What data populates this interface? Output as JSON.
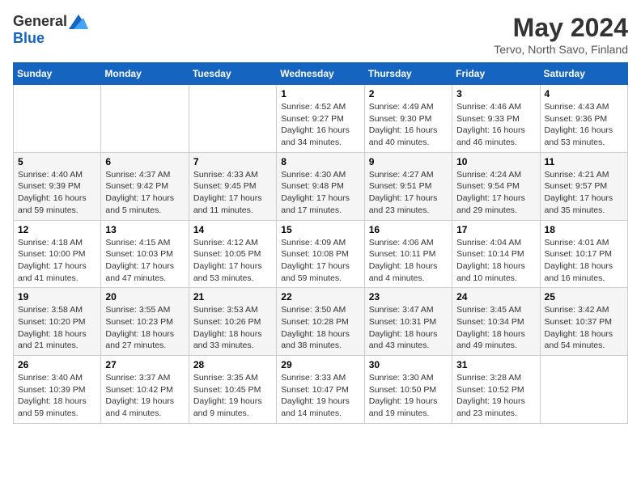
{
  "logo": {
    "general": "General",
    "blue": "Blue"
  },
  "title": "May 2024",
  "subtitle": "Tervo, North Savo, Finland",
  "days_of_week": [
    "Sunday",
    "Monday",
    "Tuesday",
    "Wednesday",
    "Thursday",
    "Friday",
    "Saturday"
  ],
  "weeks": [
    [
      {
        "day": "",
        "info": ""
      },
      {
        "day": "",
        "info": ""
      },
      {
        "day": "",
        "info": ""
      },
      {
        "day": "1",
        "info": "Sunrise: 4:52 AM\nSunset: 9:27 PM\nDaylight: 16 hours\nand 34 minutes."
      },
      {
        "day": "2",
        "info": "Sunrise: 4:49 AM\nSunset: 9:30 PM\nDaylight: 16 hours\nand 40 minutes."
      },
      {
        "day": "3",
        "info": "Sunrise: 4:46 AM\nSunset: 9:33 PM\nDaylight: 16 hours\nand 46 minutes."
      },
      {
        "day": "4",
        "info": "Sunrise: 4:43 AM\nSunset: 9:36 PM\nDaylight: 16 hours\nand 53 minutes."
      }
    ],
    [
      {
        "day": "5",
        "info": "Sunrise: 4:40 AM\nSunset: 9:39 PM\nDaylight: 16 hours\nand 59 minutes."
      },
      {
        "day": "6",
        "info": "Sunrise: 4:37 AM\nSunset: 9:42 PM\nDaylight: 17 hours\nand 5 minutes."
      },
      {
        "day": "7",
        "info": "Sunrise: 4:33 AM\nSunset: 9:45 PM\nDaylight: 17 hours\nand 11 minutes."
      },
      {
        "day": "8",
        "info": "Sunrise: 4:30 AM\nSunset: 9:48 PM\nDaylight: 17 hours\nand 17 minutes."
      },
      {
        "day": "9",
        "info": "Sunrise: 4:27 AM\nSunset: 9:51 PM\nDaylight: 17 hours\nand 23 minutes."
      },
      {
        "day": "10",
        "info": "Sunrise: 4:24 AM\nSunset: 9:54 PM\nDaylight: 17 hours\nand 29 minutes."
      },
      {
        "day": "11",
        "info": "Sunrise: 4:21 AM\nSunset: 9:57 PM\nDaylight: 17 hours\nand 35 minutes."
      }
    ],
    [
      {
        "day": "12",
        "info": "Sunrise: 4:18 AM\nSunset: 10:00 PM\nDaylight: 17 hours\nand 41 minutes."
      },
      {
        "day": "13",
        "info": "Sunrise: 4:15 AM\nSunset: 10:03 PM\nDaylight: 17 hours\nand 47 minutes."
      },
      {
        "day": "14",
        "info": "Sunrise: 4:12 AM\nSunset: 10:05 PM\nDaylight: 17 hours\nand 53 minutes."
      },
      {
        "day": "15",
        "info": "Sunrise: 4:09 AM\nSunset: 10:08 PM\nDaylight: 17 hours\nand 59 minutes."
      },
      {
        "day": "16",
        "info": "Sunrise: 4:06 AM\nSunset: 10:11 PM\nDaylight: 18 hours\nand 4 minutes."
      },
      {
        "day": "17",
        "info": "Sunrise: 4:04 AM\nSunset: 10:14 PM\nDaylight: 18 hours\nand 10 minutes."
      },
      {
        "day": "18",
        "info": "Sunrise: 4:01 AM\nSunset: 10:17 PM\nDaylight: 18 hours\nand 16 minutes."
      }
    ],
    [
      {
        "day": "19",
        "info": "Sunrise: 3:58 AM\nSunset: 10:20 PM\nDaylight: 18 hours\nand 21 minutes."
      },
      {
        "day": "20",
        "info": "Sunrise: 3:55 AM\nSunset: 10:23 PM\nDaylight: 18 hours\nand 27 minutes."
      },
      {
        "day": "21",
        "info": "Sunrise: 3:53 AM\nSunset: 10:26 PM\nDaylight: 18 hours\nand 33 minutes."
      },
      {
        "day": "22",
        "info": "Sunrise: 3:50 AM\nSunset: 10:28 PM\nDaylight: 18 hours\nand 38 minutes."
      },
      {
        "day": "23",
        "info": "Sunrise: 3:47 AM\nSunset: 10:31 PM\nDaylight: 18 hours\nand 43 minutes."
      },
      {
        "day": "24",
        "info": "Sunrise: 3:45 AM\nSunset: 10:34 PM\nDaylight: 18 hours\nand 49 minutes."
      },
      {
        "day": "25",
        "info": "Sunrise: 3:42 AM\nSunset: 10:37 PM\nDaylight: 18 hours\nand 54 minutes."
      }
    ],
    [
      {
        "day": "26",
        "info": "Sunrise: 3:40 AM\nSunset: 10:39 PM\nDaylight: 18 hours\nand 59 minutes."
      },
      {
        "day": "27",
        "info": "Sunrise: 3:37 AM\nSunset: 10:42 PM\nDaylight: 19 hours\nand 4 minutes."
      },
      {
        "day": "28",
        "info": "Sunrise: 3:35 AM\nSunset: 10:45 PM\nDaylight: 19 hours\nand 9 minutes."
      },
      {
        "day": "29",
        "info": "Sunrise: 3:33 AM\nSunset: 10:47 PM\nDaylight: 19 hours\nand 14 minutes."
      },
      {
        "day": "30",
        "info": "Sunrise: 3:30 AM\nSunset: 10:50 PM\nDaylight: 19 hours\nand 19 minutes."
      },
      {
        "day": "31",
        "info": "Sunrise: 3:28 AM\nSunset: 10:52 PM\nDaylight: 19 hours\nand 23 minutes."
      },
      {
        "day": "",
        "info": ""
      }
    ]
  ]
}
